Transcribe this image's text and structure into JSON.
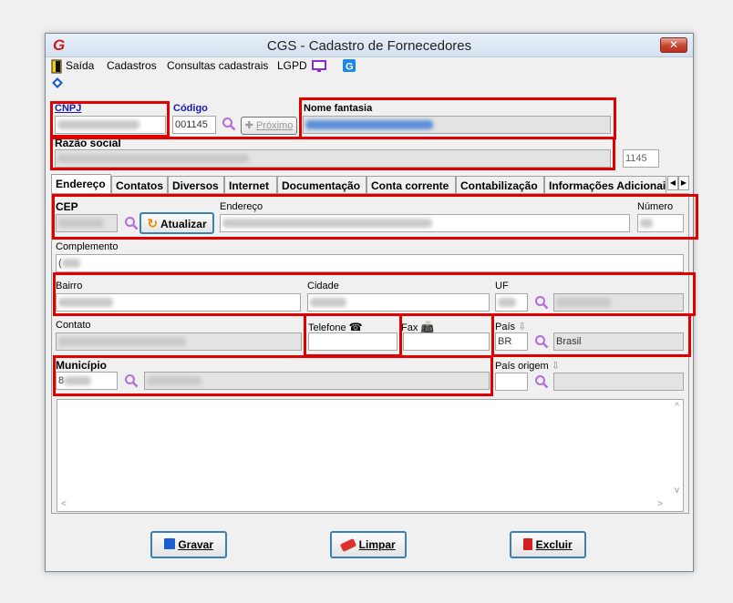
{
  "window": {
    "title": "CGS - Cadastro de Fornecedores",
    "close_glyph": "✕",
    "logo_glyph": "G"
  },
  "menu": {
    "saida": "Saída",
    "cadastros": "Cadastros",
    "consultas": "Consultas cadastrais",
    "lgpd": "LGPD"
  },
  "header": {
    "cnpj_label": "CNPJ",
    "cnpj_value": "",
    "codigo_label": "Código",
    "codigo_value": "001145",
    "proximo_label": "Próximo",
    "nome_fantasia_label": "Nome fantasia",
    "razao_social_label": "Razão social",
    "side_code_value": "1145"
  },
  "tabs": [
    {
      "label": "Endereço",
      "active": true
    },
    {
      "label": "Contatos"
    },
    {
      "label": "Diversos"
    },
    {
      "label": "Internet"
    },
    {
      "label": "Documentação"
    },
    {
      "label": "Conta corrente"
    },
    {
      "label": "Contabilização"
    },
    {
      "label": "Informações Adicionai"
    }
  ],
  "address": {
    "cep_label": "CEP",
    "atualizar_label": "Atualizar",
    "endereco_label": "Endereço",
    "numero_label": "Número",
    "complemento_label": "Complemento",
    "complemento_value": "(",
    "bairro_label": "Bairro",
    "cidade_label": "Cidade",
    "uf_label": "UF",
    "contato_label": "Contato",
    "telefone_label": "Telefone",
    "fax_label": "Fax",
    "pais_label": "País",
    "pais_code": "BR",
    "pais_name": "Brasil",
    "municipio_label": "Município",
    "municipio_value": "8",
    "pais_origem_label": "País origem"
  },
  "buttons": {
    "gravar": "Gravar",
    "limpar": "Limpar",
    "excluir": "Excluir"
  },
  "colors": {
    "highlight": "#e00000",
    "link": "#1a1aa8",
    "search_icon": "#b070d8"
  }
}
